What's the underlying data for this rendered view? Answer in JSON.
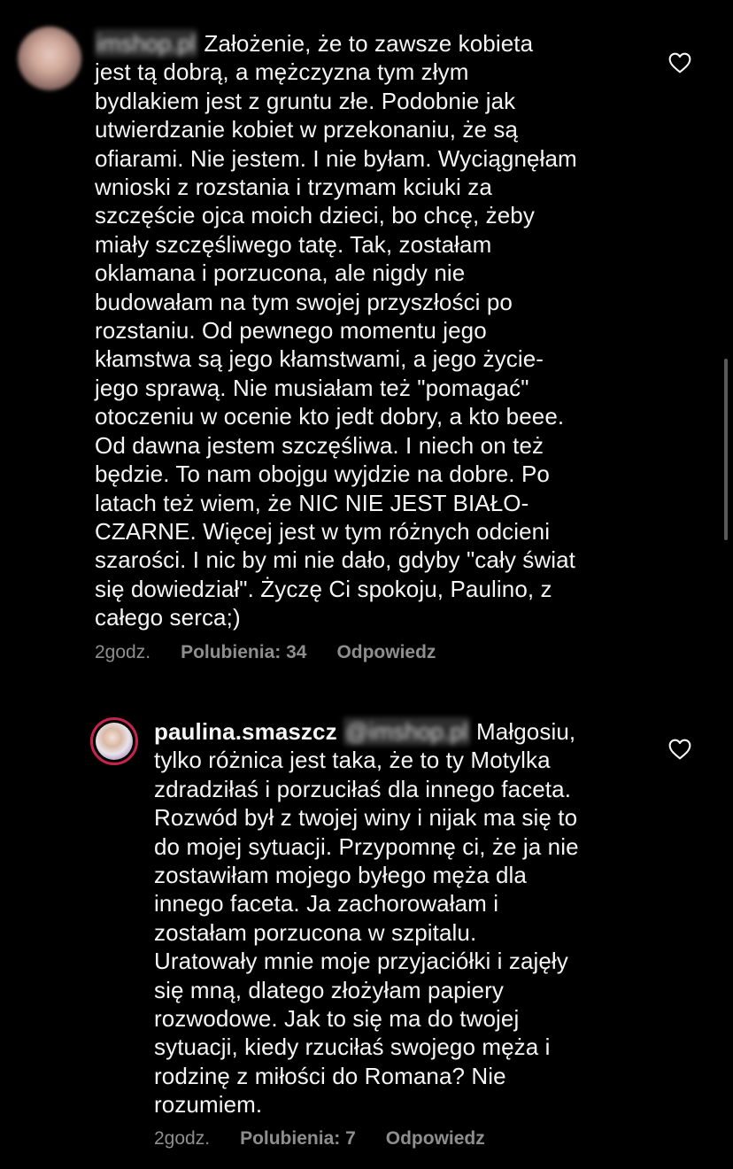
{
  "comments": [
    {
      "username_blurred": "imshop.pl",
      "text": " Założenie, że to zawsze kobieta\njest tą dobrą, a mężczyzna tym złym\nbydlakiem jest z gruntu złe. Podobnie jak\nutwierdzanie kobiet w przekonaniu, że są\nofiarami. Nie jestem. I nie byłam. Wyciągnęłam\nwnioski z rozstania i trzymam kciuki za\nszczęście ojca moich dzieci, bo chcę, żeby\nmiały szczęśliwego tatę. Tak, zostałam\noklamana i porzucona, ale nigdy nie\nbudowałam na tym swojej przyszłości po\nrozstaniu. Od pewnego momentu jego\nkłamstwa są jego kłamstwami, a jego życie-\njego sprawą. Nie musiałam też \"pomagać\"\notoczeniu w ocenie kto jedt dobry, a kto beee.\nOd dawna jestem szczęśliwa. I niech on też\nbędzie. To nam obojgu wyjdzie na dobre. Po\nlatach też wiem, że NIC NIE JEST BIAŁO-\nCZARNE. Więcej jest w tym różnych odcieni\nszarości. I nic by mi nie dało, gdyby \"cały świat\nsię dowiedział\". Życzę Ci spokoju, Paulino, z\ncałego serca;)",
      "time": "2godz.",
      "likes": "Polubienia: 34",
      "reply": "Odpowiedz"
    },
    {
      "username": "paulina.smaszcz",
      "mention_blurred": "@imshop.pl",
      "text": " Małgosiu,\ntylko różnica jest taka, że to ty Motylka\nzdradziłaś i porzuciłaś dla innego faceta.\nRozwód był z twojej winy i nijak ma się to\ndo mojej sytuacji. Przypomnę ci, że ja nie\nzostawiłam mojego byłego męża dla\ninnego faceta. Ja zachorowałam i\nzostałam porzucona w szpitalu.\nUratowały mnie moje przyjaciółki i zajęły\nsię mną, dlatego złożyłam papiery\nrozwodowe. Jak to się ma do twojej\nsytuacji, kiedy rzuciłaś swojego męża i\nrodzinę z miłości do Romana? Nie\nrozumiem.",
      "time": "2godz.",
      "likes": "Polubienia: 7",
      "reply": "Odpowiedz"
    }
  ],
  "icons": {
    "like": "heart-outline-icon"
  },
  "colors": {
    "background": "#000000",
    "text": "#f5f5f5",
    "meta": "#8e8e8e",
    "story_ring": "#c8234f"
  }
}
